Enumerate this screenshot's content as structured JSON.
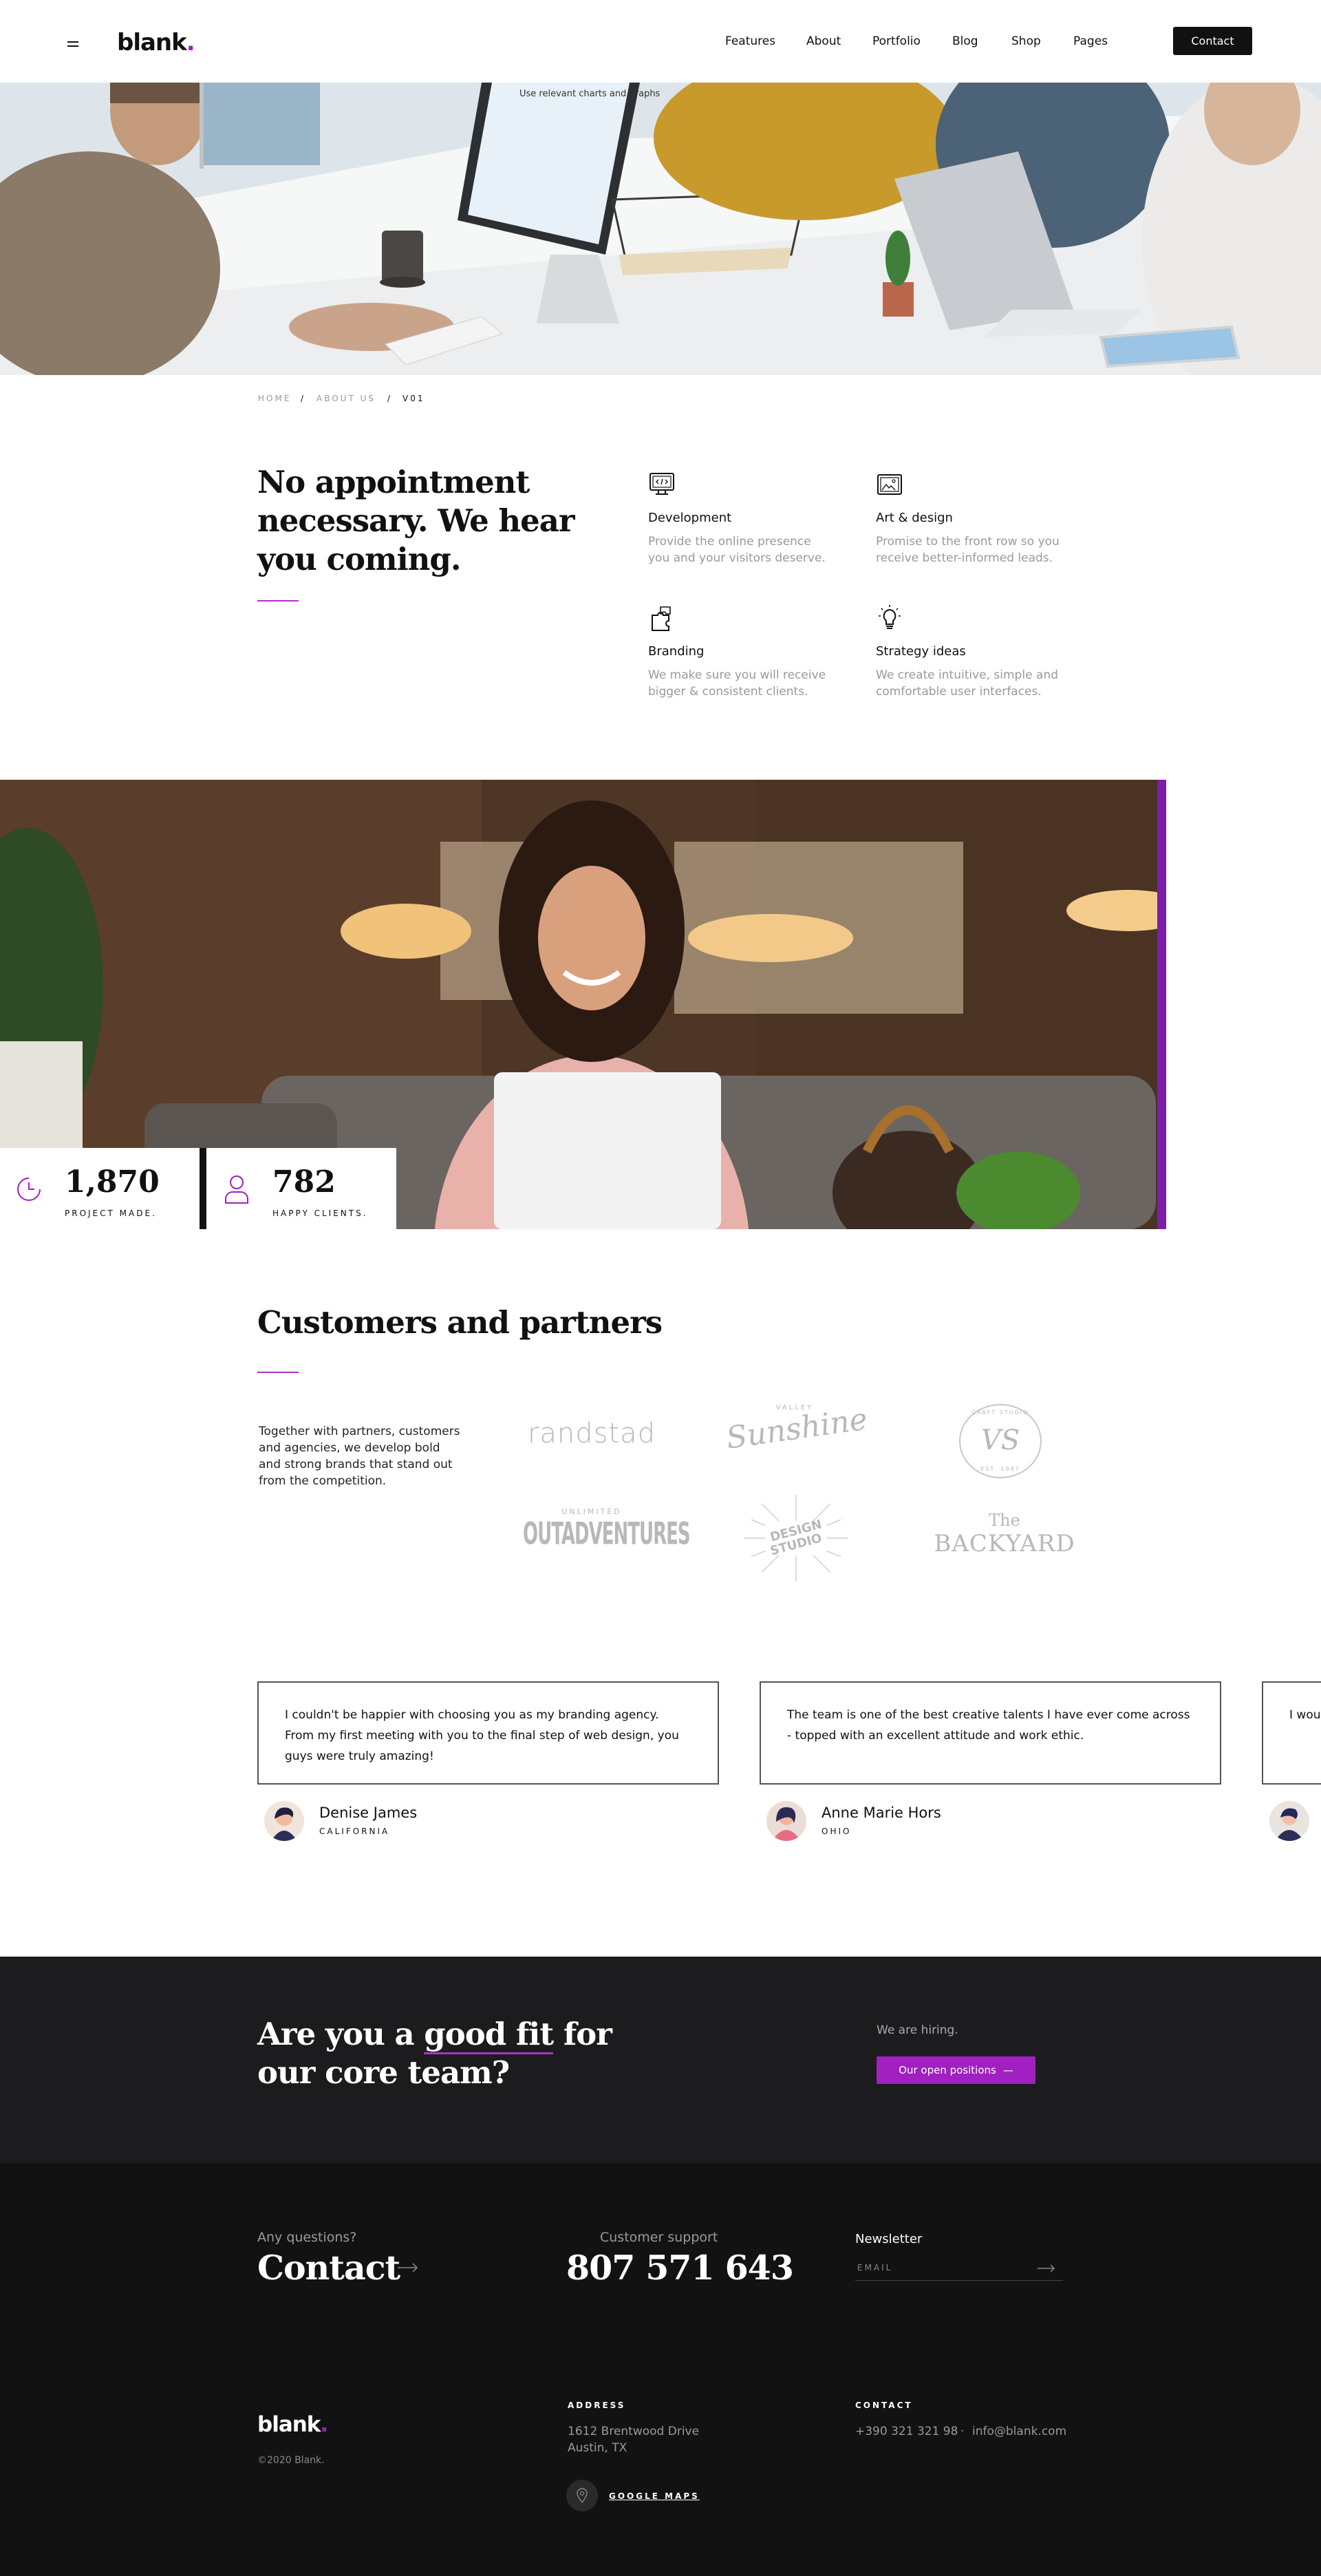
{
  "nav": {
    "logo": "blank",
    "logo_dot": ".",
    "links": [
      "Features",
      "About",
      "Portfolio",
      "Blog",
      "Shop",
      "Pages"
    ],
    "contact": "Contact"
  },
  "breadcrumb": {
    "home": "HOME",
    "sep1": "/",
    "about": "ABOUT US",
    "sep2": "/",
    "current": "V01"
  },
  "intro": {
    "headline": "No appointment necessary. We hear you coming.",
    "services": [
      {
        "title": "Development",
        "desc": "Provide the online presence you and your visitors deserve.",
        "icon": "monitor-code-icon"
      },
      {
        "title": "Art & design",
        "desc": "Promise to the front row so you receive better-informed leads.",
        "icon": "picture-frame-icon"
      },
      {
        "title": "Branding",
        "desc": "We make sure you will receive bigger & consistent clients.",
        "icon": "puzzle-icon"
      },
      {
        "title": "Strategy ideas",
        "desc": "We create intuitive, simple and comfortable user interfaces.",
        "icon": "lightbulb-icon"
      }
    ]
  },
  "hero_screen_text": "Use relevant charts and graphs",
  "stats": [
    {
      "value": "1,870",
      "label": "PROJECT MADE.",
      "icon": "clock-icon"
    },
    {
      "value": "782",
      "label": "HAPPY CLIENTS.",
      "icon": "user-icon"
    }
  ],
  "customers": {
    "title": "Customers and partners",
    "text": "Together with partners, customers and agencies, we develop bold and strong brands that stand out from the competition.",
    "logos": {
      "randstad": "randstad",
      "sunshine_top": "VALLEY",
      "sunshine": "Sunshine",
      "vs": "VS",
      "vs_ring_top": "CRAFT STUDIO",
      "vs_ring_bottom": "EST. 1987",
      "outadventures_top": "UNLIMITED",
      "outadventures": "OUTADVENTURES",
      "design_studio_1": "DESIGN",
      "design_studio_2": "STUDIO",
      "backyard_1": "The",
      "backyard_2": "BACKYARD"
    }
  },
  "testimonials": [
    {
      "quote": "I couldn't be happier with choosing you as my branding agency. From my first meeting with you to the final step of web design, you guys were truly amazing!",
      "name": "Denise James",
      "location": "CALIFORNIA"
    },
    {
      "quote": "The team is one of the best creative talents I have ever come across - topped with an excellent attitude and work ethic.",
      "name": "Anne Marie Hors",
      "location": "OHIO"
    },
    {
      "quote": "I would … job yo… your t…",
      "name": "",
      "location": ""
    }
  ],
  "cta": {
    "title_1": "Are you a ",
    "title_u": "good fit",
    "title_2": " for our core team?",
    "hiring": "We are hiring.",
    "button": "Our open positions",
    "button_arrow": "—"
  },
  "footer": {
    "questions": "Any questions?",
    "contact": "Contact",
    "support_label": "Customer support",
    "support_phone": "807 571 643",
    "newsletter": "Newsletter",
    "email_placeholder": "EMAIL",
    "logo": "blank",
    "logo_dot": ".",
    "copyright": "©2020 Blank.",
    "address_label": "ADDRESS",
    "address_1": "1612  Brentwood Drive",
    "address_2": "Austin, TX",
    "maps": "GOOGLE MAPS",
    "contact_label": "CONTACT",
    "phone": "+390 321 321 98",
    "contact_sep": "·",
    "email": "info@blank.com"
  },
  "colors": {
    "accent": "#a020c0",
    "dark": "#1c1c1e",
    "footer": "#121213"
  }
}
